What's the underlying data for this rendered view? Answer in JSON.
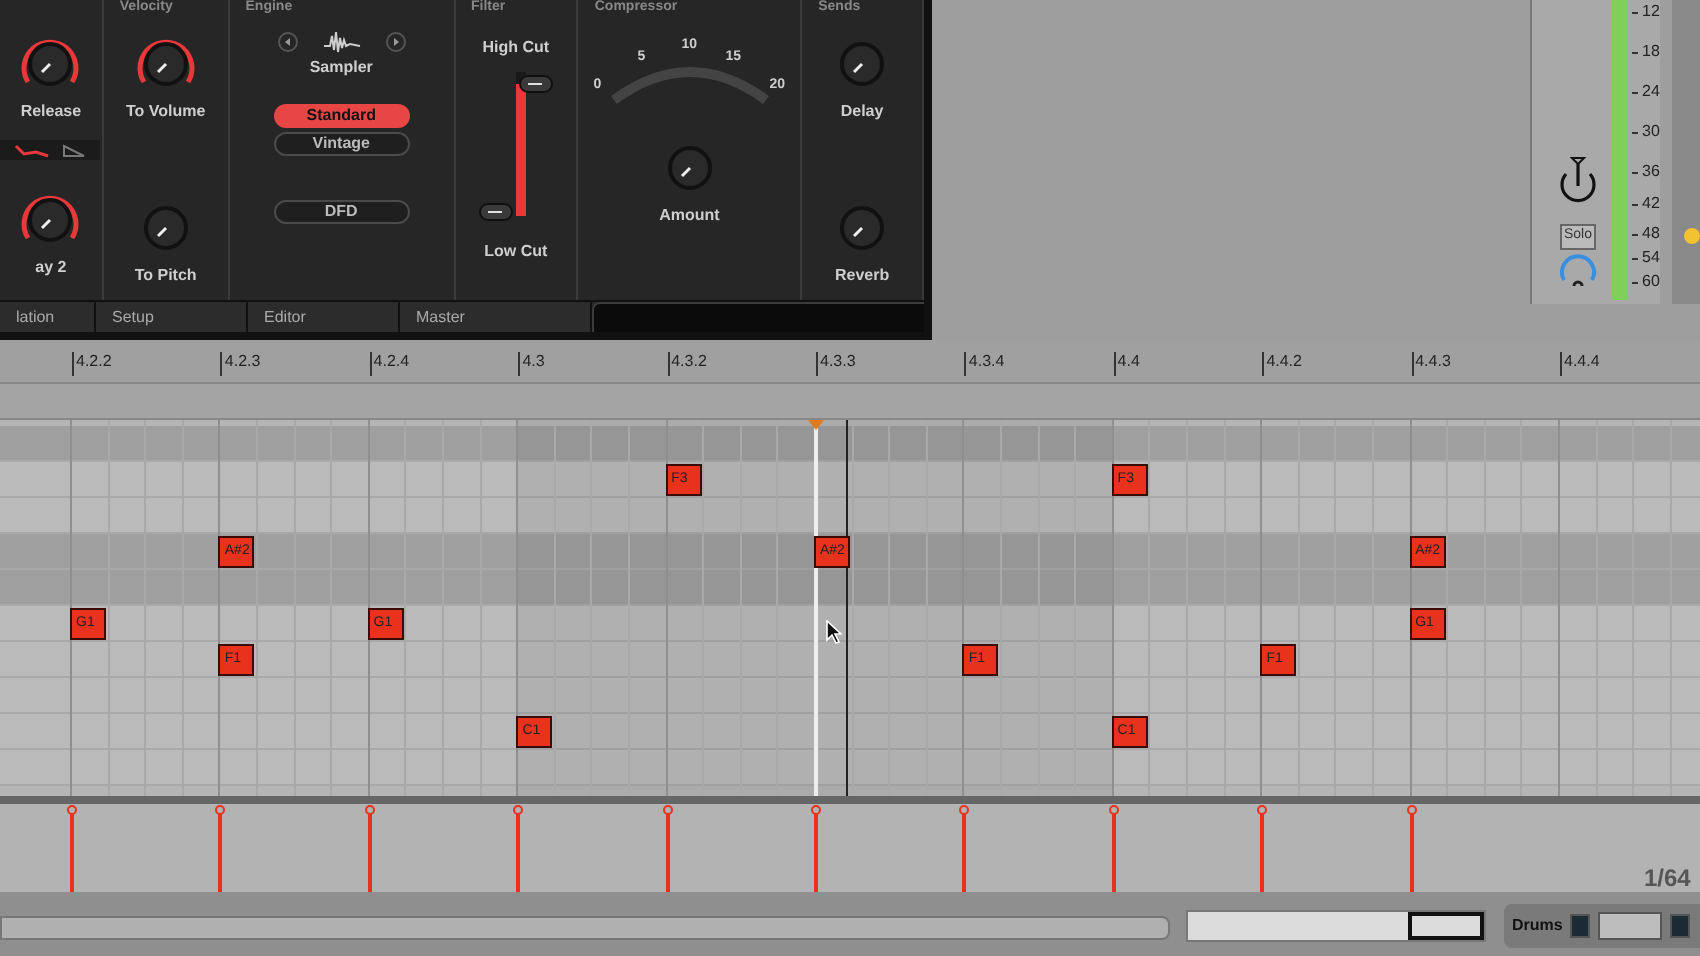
{
  "panel": {
    "headers": [
      "Velocity",
      "Engine",
      "Filter",
      "Compressor",
      "Sends"
    ],
    "left_knobs": [
      {
        "label": "Release",
        "modulated": true
      },
      {
        "label": "ay 2",
        "modulated": true
      }
    ],
    "velocity_knobs": [
      {
        "label": "To Volume",
        "modulated": true
      },
      {
        "label": "To Pitch",
        "modulated": false
      }
    ],
    "engine": {
      "name": "Sampler",
      "modes": [
        {
          "label": "Standard",
          "selected": true
        },
        {
          "label": "Vintage",
          "selected": false
        }
      ],
      "dfd": "DFD"
    },
    "filter": {
      "high_label": "High Cut",
      "low_label": "Low Cut",
      "level": 0.92
    },
    "compressor": {
      "scale": [
        "0",
        "5",
        "10",
        "15",
        "20"
      ],
      "knob_label": "Amount"
    },
    "sends": [
      {
        "label": "Delay"
      },
      {
        "label": "Reverb"
      }
    ],
    "tabs": [
      "lation",
      "Setup",
      "Editor",
      "Master"
    ]
  },
  "meter": {
    "scale": [
      "12",
      "18",
      "24",
      "30",
      "36",
      "42",
      "48",
      "54",
      "60"
    ],
    "solo": "Solo"
  },
  "ruler": {
    "ticks": [
      "4.2.2",
      "4.2.3",
      "4.2.4",
      "4.3",
      "4.3.2",
      "4.3.3",
      "4.3.4",
      "4.4",
      "4.4.2",
      "4.4.3",
      "4.4.4"
    ]
  },
  "lanes": [
    {
      "shaded": true,
      "cells": [
        null,
        null,
        null,
        null,
        null,
        null,
        null,
        null,
        null,
        null,
        null
      ]
    },
    {
      "shaded": false,
      "cells": [
        null,
        null,
        null,
        null,
        "F3",
        null,
        null,
        "F3",
        null,
        null,
        null
      ]
    },
    {
      "shaded": false,
      "cells": [
        null,
        null,
        null,
        null,
        null,
        null,
        null,
        null,
        null,
        null,
        null
      ]
    },
    {
      "shaded": true,
      "cells": [
        null,
        "A#2",
        null,
        null,
        null,
        "A#2",
        null,
        null,
        null,
        "A#2",
        null
      ]
    },
    {
      "shaded": true,
      "cells": [
        null,
        null,
        null,
        null,
        null,
        null,
        null,
        null,
        null,
        null,
        null
      ]
    },
    {
      "shaded": false,
      "cells": [
        "G1",
        null,
        "G1",
        null,
        null,
        null,
        null,
        null,
        null,
        "G1",
        null
      ]
    },
    {
      "shaded": false,
      "cells": [
        null,
        "F1",
        null,
        null,
        null,
        null,
        "F1",
        null,
        "F1",
        null,
        null
      ]
    },
    {
      "shaded": false,
      "cells": [
        null,
        null,
        null,
        null,
        null,
        null,
        null,
        null,
        null,
        null,
        null
      ]
    },
    {
      "shaded": false,
      "cells": [
        null,
        null,
        null,
        "C1",
        null,
        null,
        null,
        "C1",
        null,
        null,
        null
      ]
    },
    {
      "shaded": false,
      "cells": [
        null,
        null,
        null,
        null,
        null,
        null,
        null,
        null,
        null,
        null,
        null
      ]
    }
  ],
  "velocity_lane": {
    "resolution": "1/64"
  },
  "bottom": {
    "track": "Drums"
  }
}
